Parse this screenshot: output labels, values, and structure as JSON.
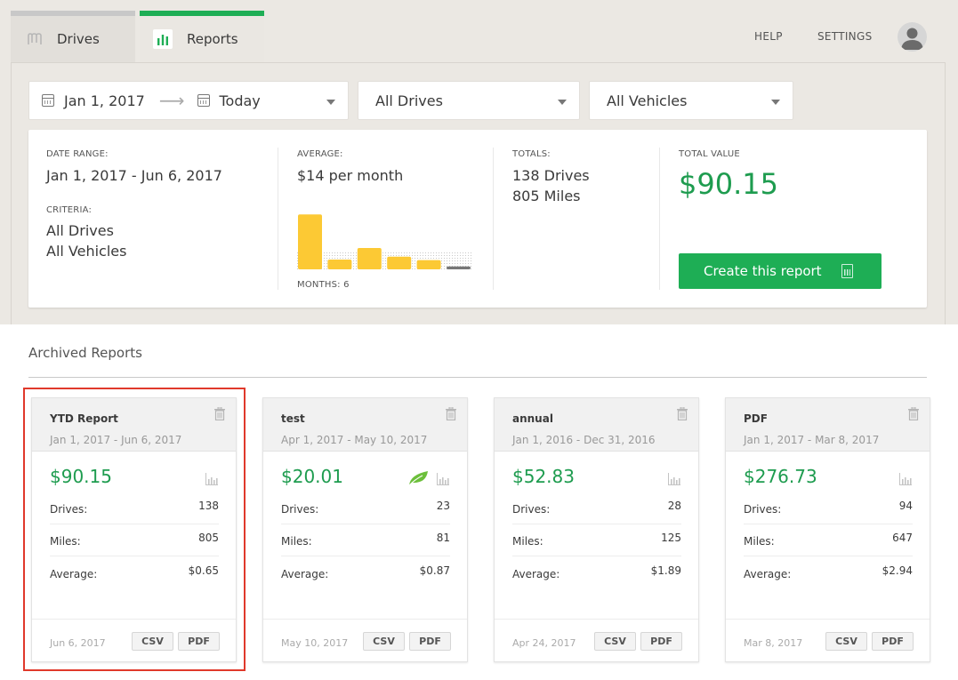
{
  "tabs": [
    {
      "label": "Drives",
      "icon": "mileiq-logo-icon",
      "active": false
    },
    {
      "label": "Reports",
      "icon": "bar-chart-icon",
      "active": true
    }
  ],
  "header_links": {
    "help": "HELP",
    "settings": "SETTINGS"
  },
  "filters": {
    "date_start": "Jan 1, 2017",
    "date_end": "Today",
    "drives": "All Drives",
    "vehicles": "All Vehicles"
  },
  "summary": {
    "date_range_label": "DATE RANGE:",
    "date_range_value": "Jan 1, 2017 - Jun 6, 2017",
    "criteria_label": "CRITERIA:",
    "criteria_drives": "All Drives",
    "criteria_vehicles": "All Vehicles",
    "average_label": "AVERAGE:",
    "average_value": "$14 per month",
    "months_label": "MONTHS: 6",
    "totals_label": "TOTALS:",
    "totals_drives": "138 Drives",
    "totals_miles": "805 Miles",
    "total_value_label": "TOTAL VALUE",
    "total_value": "$90.15",
    "create_button": "Create this report",
    "monthly_values": [
      0.95,
      0.17,
      0.37,
      0.22,
      0.16,
      0.05
    ]
  },
  "archived": {
    "title": "Archived Reports",
    "cards": [
      {
        "name": "YTD Report",
        "range": "Jan 1, 2017 - Jun 6, 2017",
        "amount": "$90.15",
        "drives": "138",
        "miles": "805",
        "average": "$0.65",
        "date": "Jun 6, 2017",
        "leaf": false,
        "selected": true
      },
      {
        "name": "test",
        "range": "Apr 1, 2017 - May 10, 2017",
        "amount": "$20.01",
        "drives": "23",
        "miles": "81",
        "average": "$0.87",
        "date": "May 10, 2017",
        "leaf": true,
        "selected": false
      },
      {
        "name": "annual",
        "range": "Jan 1, 2016 - Dec 31, 2016",
        "amount": "$52.83",
        "drives": "28",
        "miles": "125",
        "average": "$1.89",
        "date": "Apr 24, 2017",
        "leaf": false,
        "selected": false
      },
      {
        "name": "PDF",
        "range": "Jan 1, 2017 - Mar 8, 2017",
        "amount": "$276.73",
        "drives": "94",
        "miles": "647",
        "average": "$2.94",
        "date": "Mar 8, 2017",
        "leaf": false,
        "selected": false
      }
    ],
    "labels": {
      "drives": "Drives:",
      "miles": "Miles:",
      "average": "Average:",
      "csv": "CSV",
      "pdf": "PDF"
    }
  },
  "colors": {
    "accent_green": "#1eae55",
    "money_green": "#1e9c4f",
    "bar_yellow": "#fcc934",
    "selection_red": "#e0392b"
  }
}
